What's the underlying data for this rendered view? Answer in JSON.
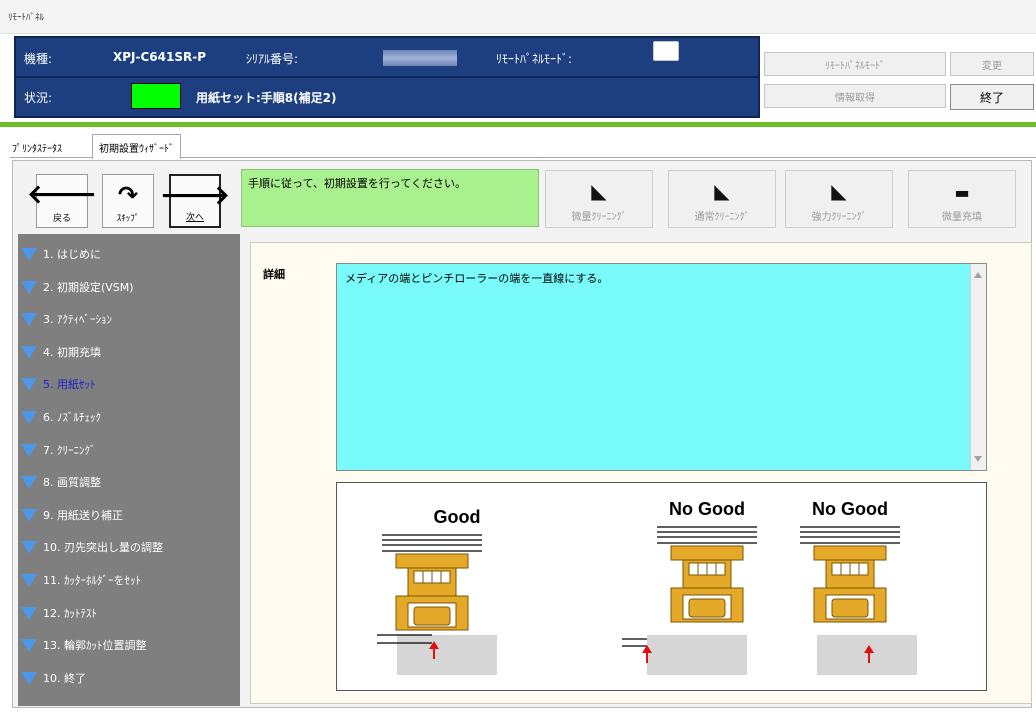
{
  "window": {
    "title": "ﾘﾓｰﾄﾊﾟﾈﾙ"
  },
  "info": {
    "model_label": "機種:",
    "model_value": "XPJ-C641SR-P",
    "serial_label": "ｼﾘｱﾙ番号:",
    "mode_label": "ﾘﾓｰﾄﾊﾟﾈﾙﾓｰﾄﾞ:",
    "status_label": "状況:",
    "status_value": "用紙セット:手順8(補足2)",
    "status_color": "#00ff00"
  },
  "buttons": {
    "remote_mode": "ﾘﾓｰﾄﾊﾟﾈﾙﾓｰﾄﾞ",
    "change": "変更",
    "get_info": "情報取得",
    "exit": "終了"
  },
  "tabs": [
    {
      "label": "ﾌﾟﾘﾝﾀｽﾃｰﾀｽ"
    },
    {
      "label": "初期設置ｳｨｻﾞｰﾄﾞ"
    }
  ],
  "nav": {
    "back": "戻る",
    "skip": "ｽｷｯﾌﾟ",
    "next": "次へ"
  },
  "message": "手順に従って、初期設置を行ってください。",
  "cleaning": {
    "micro_clean": "微量ｸﾘｰﾆﾝｸﾞ",
    "normal_clean": "通常ｸﾘｰﾆﾝｸﾞ",
    "strong_clean": "強力ｸﾘｰﾆﾝｸﾞ",
    "micro_fill": "微量充填"
  },
  "steps": [
    {
      "label": "1. はじめに"
    },
    {
      "label": "2. 初期設定(VSM)"
    },
    {
      "label": "3. ｱｸﾃｨﾍﾞｰｼｮﾝ"
    },
    {
      "label": "4. 初期充填"
    },
    {
      "label": "5. 用紙ｾｯﾄ"
    },
    {
      "label": "6. ﾉｽﾞﾙﾁｪｯｸ"
    },
    {
      "label": "7. ｸﾘｰﾆﾝｸﾞ"
    },
    {
      "label": "8. 画質調整"
    },
    {
      "label": "9. 用紙送り補正"
    },
    {
      "label": "10. 刃先突出し量の調整"
    },
    {
      "label": "11. ｶｯﾀｰﾎﾙﾀﾞｰをｾｯﾄ"
    },
    {
      "label": "12. ｶｯﾄﾃｽﾄ"
    },
    {
      "label": "13. 輪郭ｶｯﾄ位置調整"
    },
    {
      "label": "10. 終了"
    }
  ],
  "current_step_index": 4,
  "detail": {
    "label": "詳細",
    "text": "メディアの端とピンチローラーの端を一直線にする。"
  },
  "illustration": {
    "good": "Good",
    "nogood1": "No Good",
    "nogood2": "No Good"
  }
}
